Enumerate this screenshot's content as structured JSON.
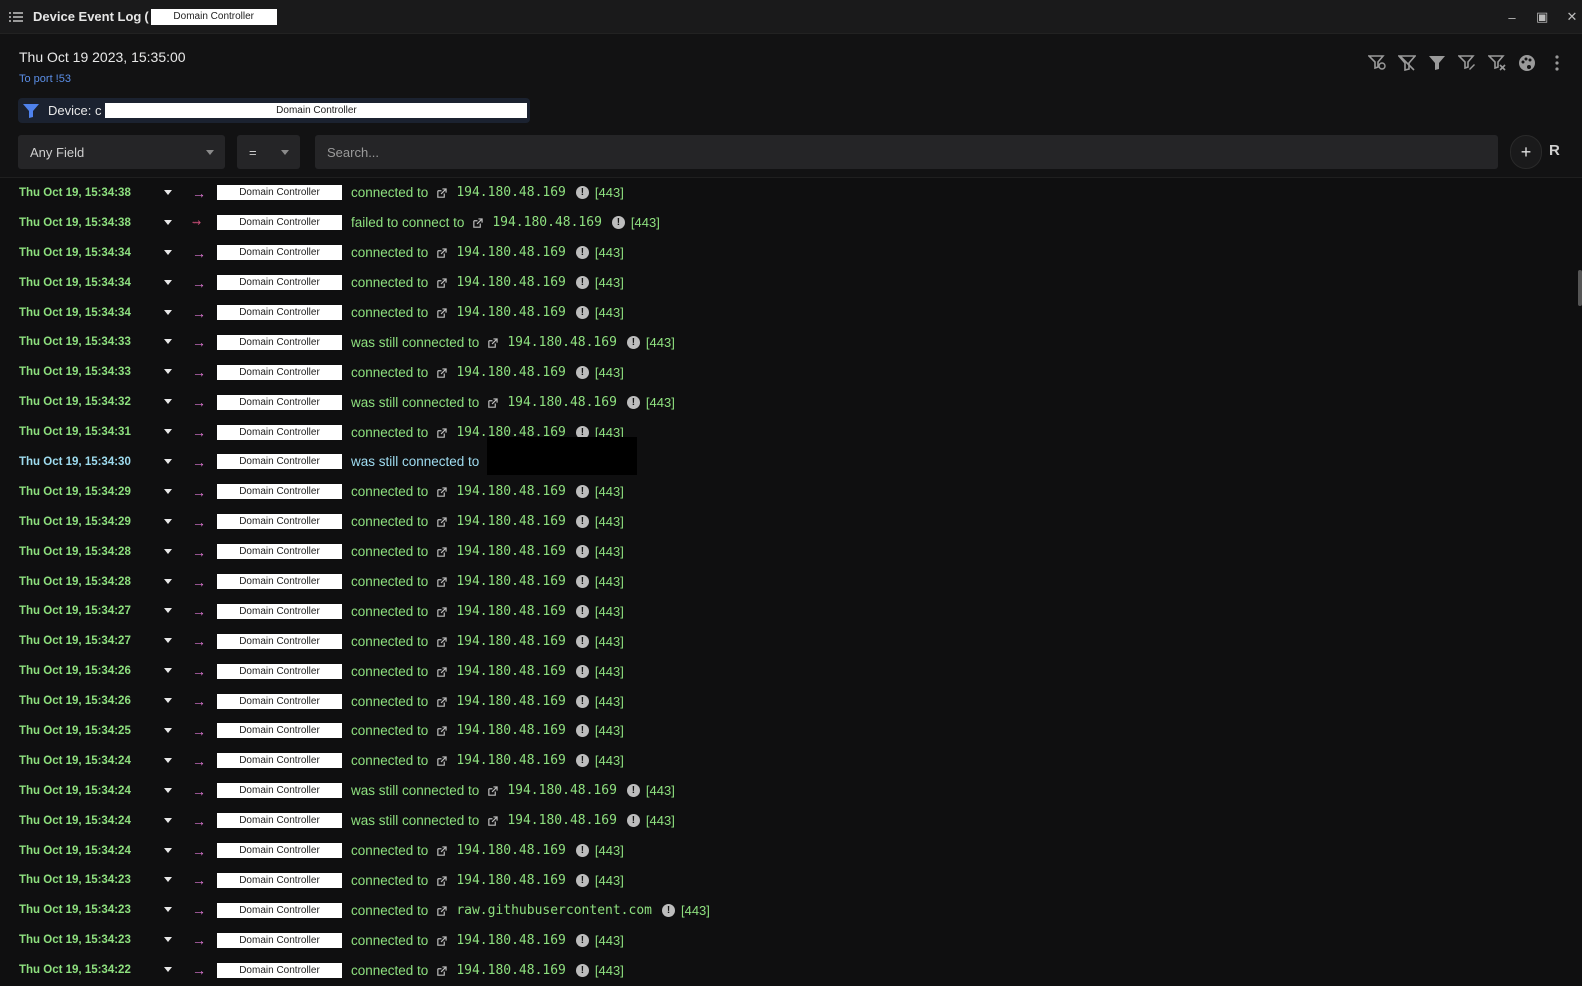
{
  "titlebar": {
    "title": "Device Event Log",
    "paren": "(",
    "device": "Domain Controller",
    "controls": [
      "minimize-icon",
      "maximize-icon",
      "close-icon"
    ]
  },
  "header": {
    "datetime": "Thu Oct 19 2023, 15:35:00",
    "subtitle": "To port !53",
    "device_filter_label": "Device: c",
    "device_filter_value": "Domain Controller",
    "toolbar_icons": [
      "filter-add-icon",
      "filter-clear-icon",
      "filter-icon",
      "filter-edit-icon",
      "filter-remove-icon",
      "palette-icon",
      "more-vertical-icon"
    ]
  },
  "search": {
    "field": "Any Field",
    "operator": "=",
    "placeholder": "Search...",
    "add_label": "+",
    "r_label": "R"
  },
  "colors": {
    "accent_green": "#8ee07f",
    "selected_blue": "#9fdcf0",
    "arrow_pink": "#e07ad6",
    "fail_red": "#c94d77",
    "filter_blue": "#5b8ee6"
  },
  "rows": [
    {
      "ts": "Thu Oct 19, 15:34:38",
      "device": "Domain Controller",
      "action": "connected to",
      "target": "194.180.48.169",
      "port": "[443]"
    },
    {
      "ts": "Thu Oct 19, 15:34:38",
      "device": "Domain Controller",
      "action": "failed to connect to",
      "target": "194.180.48.169",
      "port": "[443]"
    },
    {
      "ts": "Thu Oct 19, 15:34:34",
      "device": "Domain Controller",
      "action": "connected to",
      "target": "194.180.48.169",
      "port": "[443]"
    },
    {
      "ts": "Thu Oct 19, 15:34:34",
      "device": "Domain Controller",
      "action": "connected to",
      "target": "194.180.48.169",
      "port": "[443]"
    },
    {
      "ts": "Thu Oct 19, 15:34:34",
      "device": "Domain Controller",
      "action": "connected to",
      "target": "194.180.48.169",
      "port": "[443]"
    },
    {
      "ts": "Thu Oct 19, 15:34:33",
      "device": "Domain Controller",
      "action": "was still connected to",
      "target": "194.180.48.169",
      "port": "[443]"
    },
    {
      "ts": "Thu Oct 19, 15:34:33",
      "device": "Domain Controller",
      "action": "connected to",
      "target": "194.180.48.169",
      "port": "[443]"
    },
    {
      "ts": "Thu Oct 19, 15:34:32",
      "device": "Domain Controller",
      "action": "was still connected to",
      "target": "194.180.48.169",
      "port": "[443]"
    },
    {
      "ts": "Thu Oct 19, 15:34:31",
      "device": "Domain Controller",
      "action": "connected to",
      "target": "194.180.48.169",
      "port": "[443]"
    },
    {
      "ts": "Thu Oct 19, 15:34:30",
      "device": "Domain Controller",
      "action": "was still connected to",
      "target": "",
      "port": ""
    },
    {
      "ts": "Thu Oct 19, 15:34:29",
      "device": "Domain Controller",
      "action": "connected to",
      "target": "194.180.48.169",
      "port": "[443]"
    },
    {
      "ts": "Thu Oct 19, 15:34:29",
      "device": "Domain Controller",
      "action": "connected to",
      "target": "194.180.48.169",
      "port": "[443]"
    },
    {
      "ts": "Thu Oct 19, 15:34:28",
      "device": "Domain Controller",
      "action": "connected to",
      "target": "194.180.48.169",
      "port": "[443]"
    },
    {
      "ts": "Thu Oct 19, 15:34:28",
      "device": "Domain Controller",
      "action": "connected to",
      "target": "194.180.48.169",
      "port": "[443]"
    },
    {
      "ts": "Thu Oct 19, 15:34:27",
      "device": "Domain Controller",
      "action": "connected to",
      "target": "194.180.48.169",
      "port": "[443]"
    },
    {
      "ts": "Thu Oct 19, 15:34:27",
      "device": "Domain Controller",
      "action": "connected to",
      "target": "194.180.48.169",
      "port": "[443]"
    },
    {
      "ts": "Thu Oct 19, 15:34:26",
      "device": "Domain Controller",
      "action": "connected to",
      "target": "194.180.48.169",
      "port": "[443]"
    },
    {
      "ts": "Thu Oct 19, 15:34:26",
      "device": "Domain Controller",
      "action": "connected to",
      "target": "194.180.48.169",
      "port": "[443]"
    },
    {
      "ts": "Thu Oct 19, 15:34:25",
      "device": "Domain Controller",
      "action": "connected to",
      "target": "194.180.48.169",
      "port": "[443]"
    },
    {
      "ts": "Thu Oct 19, 15:34:24",
      "device": "Domain Controller",
      "action": "connected to",
      "target": "194.180.48.169",
      "port": "[443]"
    },
    {
      "ts": "Thu Oct 19, 15:34:24",
      "device": "Domain Controller",
      "action": "was still connected to",
      "target": "194.180.48.169",
      "port": "[443]"
    },
    {
      "ts": "Thu Oct 19, 15:34:24",
      "device": "Domain Controller",
      "action": "was still connected to",
      "target": "194.180.48.169",
      "port": "[443]"
    },
    {
      "ts": "Thu Oct 19, 15:34:24",
      "device": "Domain Controller",
      "action": "connected to",
      "target": "194.180.48.169",
      "port": "[443]"
    },
    {
      "ts": "Thu Oct 19, 15:34:23",
      "device": "Domain Controller",
      "action": "connected to",
      "target": "194.180.48.169",
      "port": "[443]"
    },
    {
      "ts": "Thu Oct 19, 15:34:23",
      "device": "Domain Controller",
      "action": "connected to",
      "target": "raw.githubusercontent.com",
      "port": "[443]"
    },
    {
      "ts": "Thu Oct 19, 15:34:23",
      "device": "Domain Controller",
      "action": "connected to",
      "target": "194.180.48.169",
      "port": "[443]"
    },
    {
      "ts": "Thu Oct 19, 15:34:22",
      "device": "Domain Controller",
      "action": "connected to",
      "target": "194.180.48.169",
      "port": "[443]"
    }
  ]
}
